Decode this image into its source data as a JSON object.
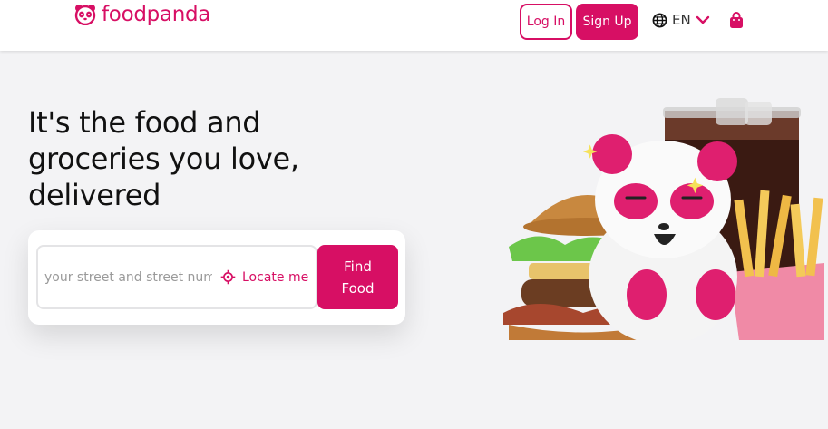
{
  "header": {
    "brand": "foodpanda",
    "login_label": "Log In",
    "signup_label": "Sign Up",
    "language": "EN"
  },
  "hero": {
    "headline": "It's the food and groceries you love, delivered"
  },
  "search": {
    "placeholder": "your street and street number",
    "locate_label": "Locate me",
    "submit_label": "Find Food"
  },
  "colors": {
    "brand": "#d70f64",
    "page_background": "#f3f3f5"
  },
  "icons": [
    "panda-logo-icon",
    "globe-icon",
    "chevron-down-icon",
    "shopping-bag-icon",
    "locate-target-icon"
  ]
}
